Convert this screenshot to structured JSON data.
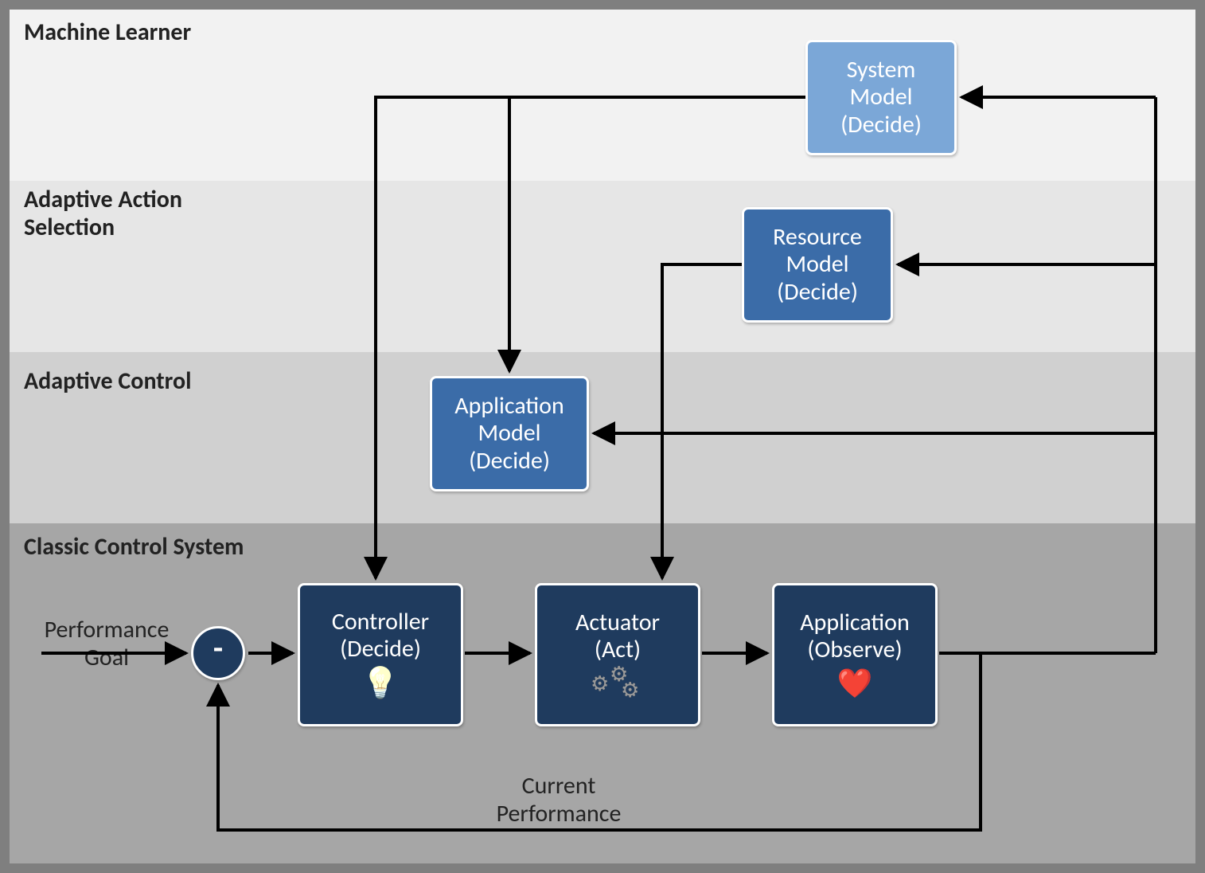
{
  "layers": {
    "l1": "Machine Learner",
    "l2_a": "Adaptive Action",
    "l2_b": "Selection",
    "l3": "Adaptive Control",
    "l4": "Classic Control System"
  },
  "nodes": {
    "system_model_a": "System",
    "system_model_b": "Model",
    "system_model_c": "(Decide)",
    "resource_model_a": "Resource",
    "resource_model_b": "Model",
    "resource_model_c": "(Decide)",
    "app_model_a": "Application",
    "app_model_b": "Model",
    "app_model_c": "(Decide)",
    "controller_a": "Controller",
    "controller_b": "(Decide)",
    "actuator_a": "Actuator",
    "actuator_b": "(Act)",
    "application_a": "Application",
    "application_b": "(Observe)"
  },
  "labels": {
    "perf_goal_a": "Performance",
    "perf_goal_b": "Goal",
    "cur_perf_a": "Current",
    "cur_perf_b": "Performance",
    "minus": "-"
  },
  "icons": {
    "bulb": "💡",
    "heart": "❤️"
  },
  "colors": {
    "frame": "#7f7f7f",
    "layer1": "#f2f2f2",
    "layer2": "#e6e6e6",
    "layer3": "#d0d0d0",
    "layer4": "#a6a6a6",
    "darkblue": "#1f3b5e",
    "midblue": "#3b6ca8",
    "lightblue": "#7ba7d7"
  }
}
